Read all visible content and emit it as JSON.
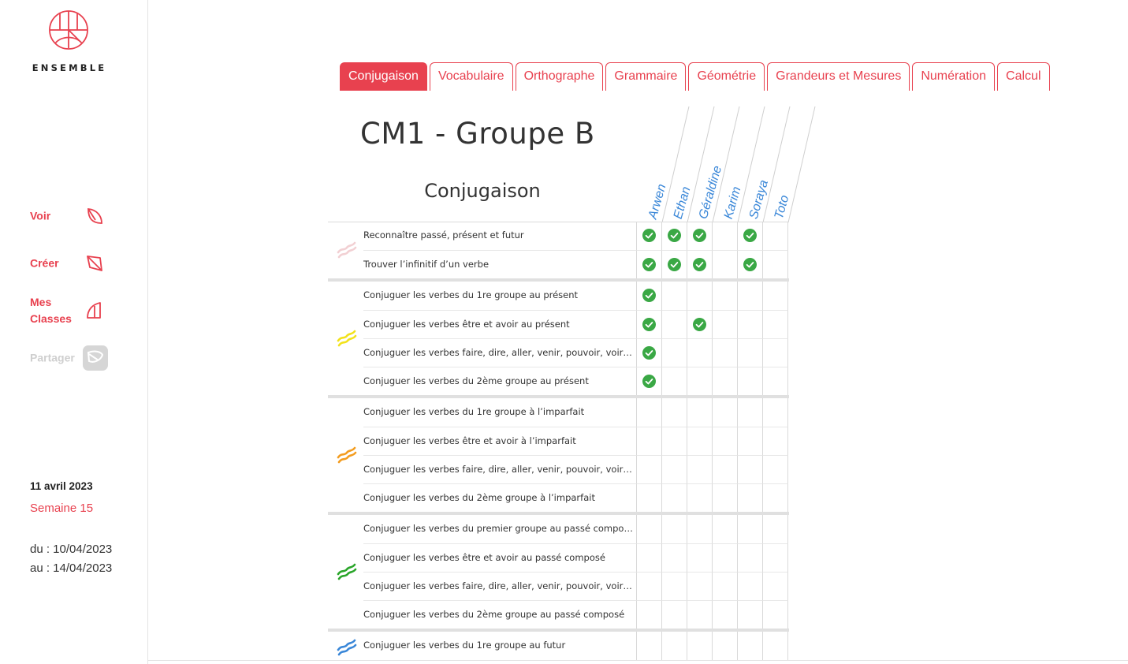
{
  "brand": {
    "name": "ENSEMBLE"
  },
  "colors": {
    "accent": "#e8414f",
    "check": "#3aa845",
    "student": "#3a87d8"
  },
  "nav": [
    {
      "id": "voir",
      "label": "Voir",
      "icon": "leaf-quarter-icon",
      "disabled": false
    },
    {
      "id": "creer",
      "label": "Créer",
      "icon": "leaf-diamond-icon",
      "disabled": false
    },
    {
      "id": "classes",
      "label": "Mes\nClasses",
      "icon": "leaf-half-icon",
      "disabled": false
    },
    {
      "id": "partager",
      "label": "Partager",
      "icon": "share-leaf-icon",
      "disabled": true
    }
  ],
  "date": {
    "today": "11 avril 2023",
    "week": "Semaine 15",
    "from": "du : 10/04/2023",
    "to": "au : 14/04/2023"
  },
  "tabs": [
    {
      "label": "Conjugaison",
      "active": true
    },
    {
      "label": "Vocabulaire",
      "active": false
    },
    {
      "label": "Orthographe",
      "active": false
    },
    {
      "label": "Grammaire",
      "active": false
    },
    {
      "label": "Géométrie",
      "active": false
    },
    {
      "label": "Grandeurs et Mesures",
      "active": false
    },
    {
      "label": "Numération",
      "active": false
    },
    {
      "label": "Calcul",
      "active": false
    }
  ],
  "page": {
    "title": "CM1 - Groupe B",
    "section": "Conjugaison"
  },
  "students": [
    "Arwen",
    "Ethan",
    "Géraldine",
    "Karim",
    "Soraya",
    "Toto"
  ],
  "groups": [
    {
      "level_color": "#f2d0d3",
      "level_icon": "level-pale-pink-icon",
      "skills": [
        {
          "label": "Reconnaître passé, présent et futur",
          "checks": [
            true,
            true,
            true,
            false,
            true,
            false
          ]
        },
        {
          "label": "Trouver l’infinitif d’un verbe",
          "checks": [
            true,
            true,
            true,
            false,
            true,
            false
          ]
        }
      ]
    },
    {
      "level_color": "#f2e21a",
      "level_icon": "level-yellow-icon",
      "skills": [
        {
          "label": "Conjuguer les verbes du 1re groupe au présent",
          "checks": [
            true,
            false,
            false,
            false,
            false,
            false
          ]
        },
        {
          "label": "Conjuguer les verbes être et avoir au présent",
          "checks": [
            true,
            false,
            true,
            false,
            false,
            false
          ]
        },
        {
          "label": "Conjuguer les verbes faire, dire, aller, venir, pouvoir, voir, vouloir et prendre au présent",
          "checks": [
            true,
            false,
            false,
            false,
            false,
            false
          ]
        },
        {
          "label": "Conjuguer les verbes du 2ème groupe au présent",
          "checks": [
            true,
            false,
            false,
            false,
            false,
            false
          ]
        }
      ]
    },
    {
      "level_color": "#f39c1f",
      "level_icon": "level-orange-icon",
      "skills": [
        {
          "label": "Conjuguer les verbes du 1re groupe à l’imparfait",
          "checks": [
            false,
            false,
            false,
            false,
            false,
            false
          ]
        },
        {
          "label": "Conjuguer les verbes être et avoir à l’imparfait",
          "checks": [
            false,
            false,
            false,
            false,
            false,
            false
          ]
        },
        {
          "label": "Conjuguer les verbes faire, dire, aller, venir, pouvoir, voir, vouloir et prendre à l’imparfait",
          "checks": [
            false,
            false,
            false,
            false,
            false,
            false
          ]
        },
        {
          "label": "Conjuguer les verbes du 2ème groupe à l’imparfait",
          "checks": [
            false,
            false,
            false,
            false,
            false,
            false
          ]
        }
      ]
    },
    {
      "level_color": "#2aa52a",
      "level_icon": "level-green-icon",
      "skills": [
        {
          "label": "Conjuguer les verbes du premier groupe au passé composé",
          "checks": [
            false,
            false,
            false,
            false,
            false,
            false
          ]
        },
        {
          "label": "Conjuguer les verbes être et avoir au passé composé",
          "checks": [
            false,
            false,
            false,
            false,
            false,
            false
          ]
        },
        {
          "label": "Conjuguer les verbes faire, dire, aller, venir, pouvoir, voir, vouloir et prendre au passé composé",
          "checks": [
            false,
            false,
            false,
            false,
            false,
            false
          ]
        },
        {
          "label": "Conjuguer les verbes du 2ème groupe au passé composé",
          "checks": [
            false,
            false,
            false,
            false,
            false,
            false
          ]
        }
      ]
    },
    {
      "level_color": "#3a87d8",
      "level_icon": "level-blue-icon",
      "skills": [
        {
          "label": "Conjuguer les verbes du 1re groupe au futur",
          "checks": [
            false,
            false,
            false,
            false,
            false,
            false
          ]
        }
      ]
    }
  ]
}
